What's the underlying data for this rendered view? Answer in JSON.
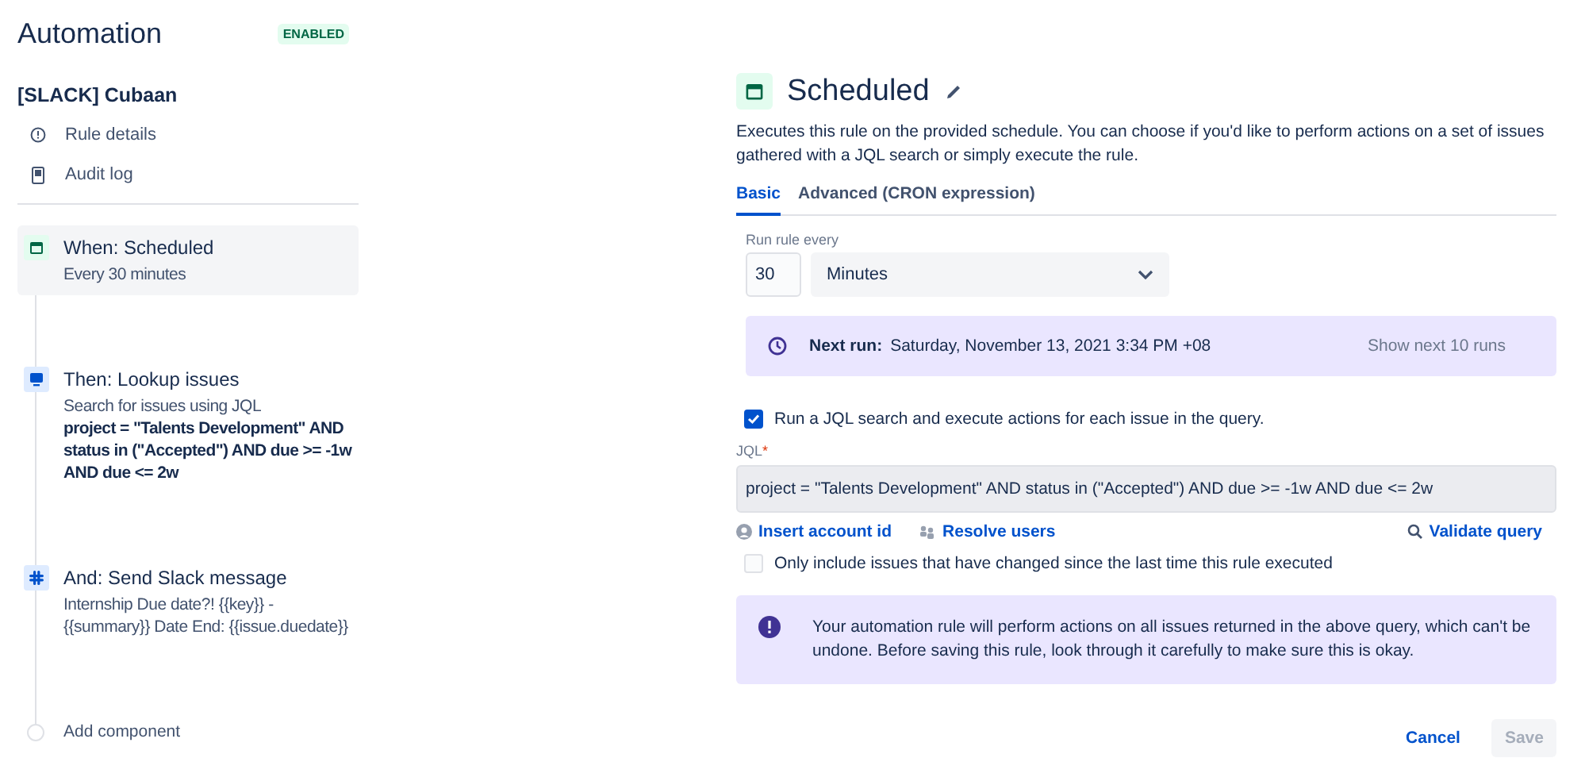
{
  "sidebar": {
    "title": "Automation",
    "status": {
      "label": "ENABLED",
      "enabled": true
    },
    "rule_name": "[SLACK] Cubaan",
    "nav": [
      {
        "kind": "info",
        "label": "Rule details"
      },
      {
        "kind": "log",
        "label": "Audit log"
      }
    ],
    "components": [
      {
        "kind": "trigger",
        "title": "When: Scheduled",
        "details": "Every 30 minutes",
        "selected": true
      },
      {
        "kind": "lookup",
        "title": "Then: Lookup issues",
        "details": "Search for issues using JQL",
        "query": "project = \"Talents Development\" AND status in (\"Accepted\") AND due >= -1w AND due <= 2w",
        "selected": false
      },
      {
        "kind": "slack",
        "title": "And: Send Slack message",
        "details": "Internship Due date?! {{key}} - {{summary}} Date End: {{issue.duedate}}",
        "selected": false
      },
      {
        "kind": "add",
        "title": "Add component",
        "selected": false
      }
    ]
  },
  "panel": {
    "title": "Scheduled",
    "description": "Executes this rule on the provided schedule. You can choose if you'd like to perform actions on a set of issues gathered with a JQL search or simply execute the rule.",
    "tabs": [
      {
        "label": "Basic",
        "selected": true
      },
      {
        "label": "Advanced (CRON expression)",
        "selected": false
      }
    ],
    "frequency": {
      "label": "Run rule every",
      "value": "30",
      "unit": "Minutes"
    },
    "next_run": {
      "label": "Next run:",
      "value": "Saturday, November 13, 2021 3:34 PM +08",
      "action": "Show next 10 runs"
    },
    "jql_checkbox": {
      "label": "Run a JQL search and execute actions for each issue in the query.",
      "checked": true
    },
    "jql": {
      "label": "JQL",
      "required_mark": "*",
      "value": "project = \"Talents Development\" AND status in (\"Accepted\") AND due >= -1w AND due <= 2w"
    },
    "links": [
      {
        "kind": "account",
        "label": "Insert account id"
      },
      {
        "kind": "users",
        "label": "Resolve users"
      },
      {
        "kind": "search",
        "label": "Validate query"
      }
    ],
    "changed_checkbox": {
      "label": "Only include issues that have changed since the last time this rule executed",
      "checked": false
    },
    "warning": "Your automation rule will perform actions on all issues returned in the above query, which can't be undone. Before saving this rule, look through it carefully to make sure this is okay.",
    "buttons": [
      {
        "kind": "cancel",
        "label": "Cancel",
        "disabled": false
      },
      {
        "kind": "save",
        "label": "Save",
        "disabled": true
      }
    ]
  }
}
